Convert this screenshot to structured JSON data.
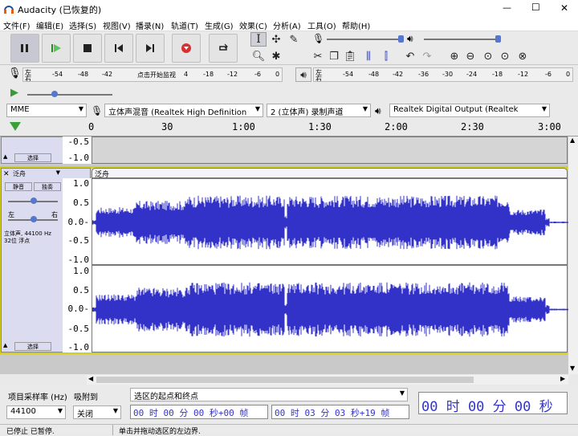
{
  "window": {
    "title": "Audacity (已恢复的)",
    "minimize": "—",
    "maximize": "☐",
    "close": "✕"
  },
  "menu": [
    "文件(F)",
    "编辑(E)",
    "选择(S)",
    "视图(V)",
    "播录(N)",
    "轨道(T)",
    "生成(G)",
    "效果(C)",
    "分析(A)",
    "工具(O)",
    "帮助(H)"
  ],
  "meters": {
    "record_l": "左",
    "record_r": "右",
    "record_ticks": [
      "-54",
      "-48",
      "-42"
    ],
    "record_hint": "点击开始监视",
    "record_ticks2": [
      "4",
      "-18",
      "-12",
      "-6",
      "0"
    ],
    "play_l": "左",
    "play_r": "右",
    "play_ticks": [
      "-54",
      "-48",
      "-42",
      "-36",
      "-30",
      "-24",
      "-18",
      "-12",
      "-6",
      "0"
    ]
  },
  "device": {
    "host": "MME",
    "input": "立体声混音 (Realtek High Definition",
    "channels": "2 (立体声) 录制声道",
    "output": "Realtek Digital Output (Realtek"
  },
  "ruler": {
    "labels": [
      "0",
      "30",
      "1:00",
      "1:30",
      "2:00",
      "2:30",
      "3:00"
    ]
  },
  "track_top": {
    "select_label": "选择",
    "scale": [
      "-0.5",
      "-1.0"
    ]
  },
  "track": {
    "name": "泛舟",
    "mute": "静音",
    "solo": "独奏",
    "pan_left": "左",
    "pan_right": "右",
    "info1": "立体声, 44100 Hz",
    "info2": "32位 浮点",
    "select_label": "选择",
    "clip_name": "泛舟",
    "scale_ch1": [
      "1.0",
      "0.5",
      "0.0-",
      "-0.5",
      "-1.0"
    ],
    "scale_ch2": [
      "1.0",
      "0.5",
      "0.0-",
      "-0.5",
      "-1.0"
    ]
  },
  "bottom": {
    "rate_label": "项目采样率 (Hz)",
    "snap_label": "吸附到",
    "rate_value": "44100",
    "snap_value": "关闭",
    "selection_label": "选区的起点和终点",
    "start_time": "00 时 00 分 00 秒+00 帧",
    "end_time": "00 时 03 分 03 秒+19 帧",
    "big_time": "00 时 00 分 00 秒"
  },
  "status": {
    "state": "已停止 已暂停.",
    "hint": "单击并拖动选区的左边界."
  },
  "colors": {
    "wave": "#3232c8",
    "accent": "#d4cf1e",
    "track_panel": "#dcdcf0"
  }
}
